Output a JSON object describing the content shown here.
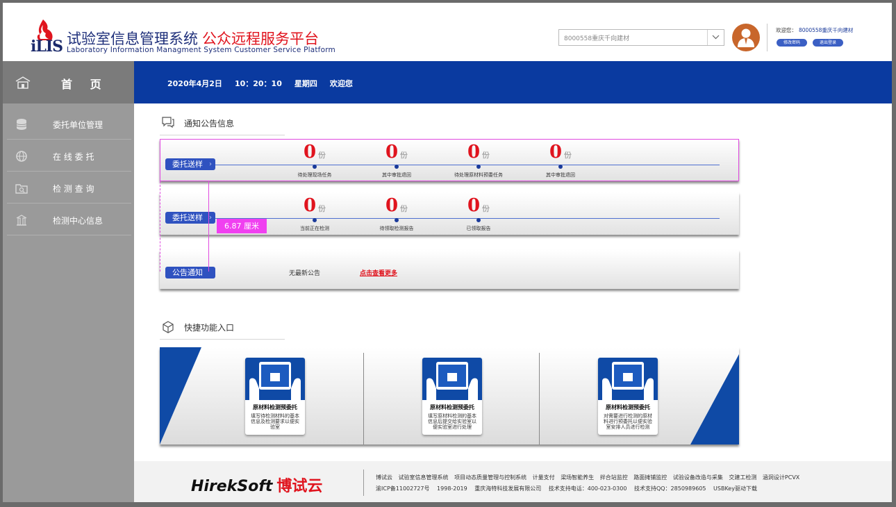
{
  "header": {
    "logo_text": "iLIS",
    "title_cn": "试验室信息管理系统",
    "title_red": "公众远程服务平台",
    "subtitle": "Laboratory Information Managment System Customer Service Platform",
    "company_select_value": "8000558重庆千向建材",
    "welcome_prefix": "欢迎您：",
    "welcome_company": "8000558重庆千向建材",
    "change_password": "修改密码",
    "logout": "退出登录"
  },
  "sidebar": {
    "home": "首 页",
    "items": [
      {
        "label": "委托单位管理",
        "icon": "database-icon"
      },
      {
        "label": "在 线 委 托",
        "icon": "globe-icon"
      },
      {
        "label": "检 测 查 询",
        "icon": "folder-search-icon"
      },
      {
        "label": "检测中心信息",
        "icon": "building-icon"
      }
    ]
  },
  "topbar": {
    "date": "2020年4月2日",
    "time": "10：20：10",
    "weekday": "星期四",
    "greeting": "欢迎您"
  },
  "notice_section": {
    "title": "通知公告信息",
    "card1": {
      "pill": "委托送样",
      "stats": [
        {
          "value": "0",
          "unit": "份",
          "label": "待处理现场任务"
        },
        {
          "value": "0",
          "unit": "份",
          "label": "其中审批退回"
        },
        {
          "value": "0",
          "unit": "份",
          "label": "待处理原材料预委任务"
        },
        {
          "value": "0",
          "unit": "份",
          "label": "其中审批退回"
        }
      ]
    },
    "card2": {
      "pill": "委托送样",
      "stats": [
        {
          "value": "0",
          "unit": "份",
          "label": "当前正在检测"
        },
        {
          "value": "0",
          "unit": "份",
          "label": "待领取检测报告"
        },
        {
          "value": "0",
          "unit": "份",
          "label": "已领取报告"
        }
      ]
    },
    "card3": {
      "pill": "公告通知",
      "no_notice": "无最新公告",
      "more_link": "点击查看更多"
    },
    "measure_label": "6.87 厘米"
  },
  "quick_section": {
    "title": "快捷功能入口",
    "cards": [
      {
        "title": "原材料检测预委托",
        "desc": "填写待检测材料的基本信息及检测要求以便实验室"
      },
      {
        "title": "原材料检测预委托",
        "desc": "填写原材料检测的基本信息后提交给实验室以便实验室进行处理"
      },
      {
        "title": "原材料检测预委托",
        "desc": "对需要进行检测的原材料进行预委托以便实验室安排人员进行检测"
      }
    ]
  },
  "footer": {
    "brand_en": "HirekSoft",
    "brand_cn": "博试云",
    "links": [
      "博试云",
      "试验室信息管理系统",
      "项目动态质量管理与控制系统",
      "计量支付",
      "梁场智能养生",
      "拌合站监控",
      "路面摊铺监控",
      "试验设备改造与采集",
      "交建工检测",
      "涵洞设计PCVX"
    ],
    "copy": [
      "渝ICP备11002727号",
      "1998-2019",
      "重庆海特科技发展有限公司",
      "技术支持电话：400-023-0300",
      "技术支持QQ：2850989605",
      "USBKey驱动下载"
    ]
  },
  "colors": {
    "primary_blue": "#0a3aa0",
    "accent_red": "#e0141e",
    "sidebar_gray": "#9a9a9a",
    "selection_magenta": "#e04ae0"
  }
}
